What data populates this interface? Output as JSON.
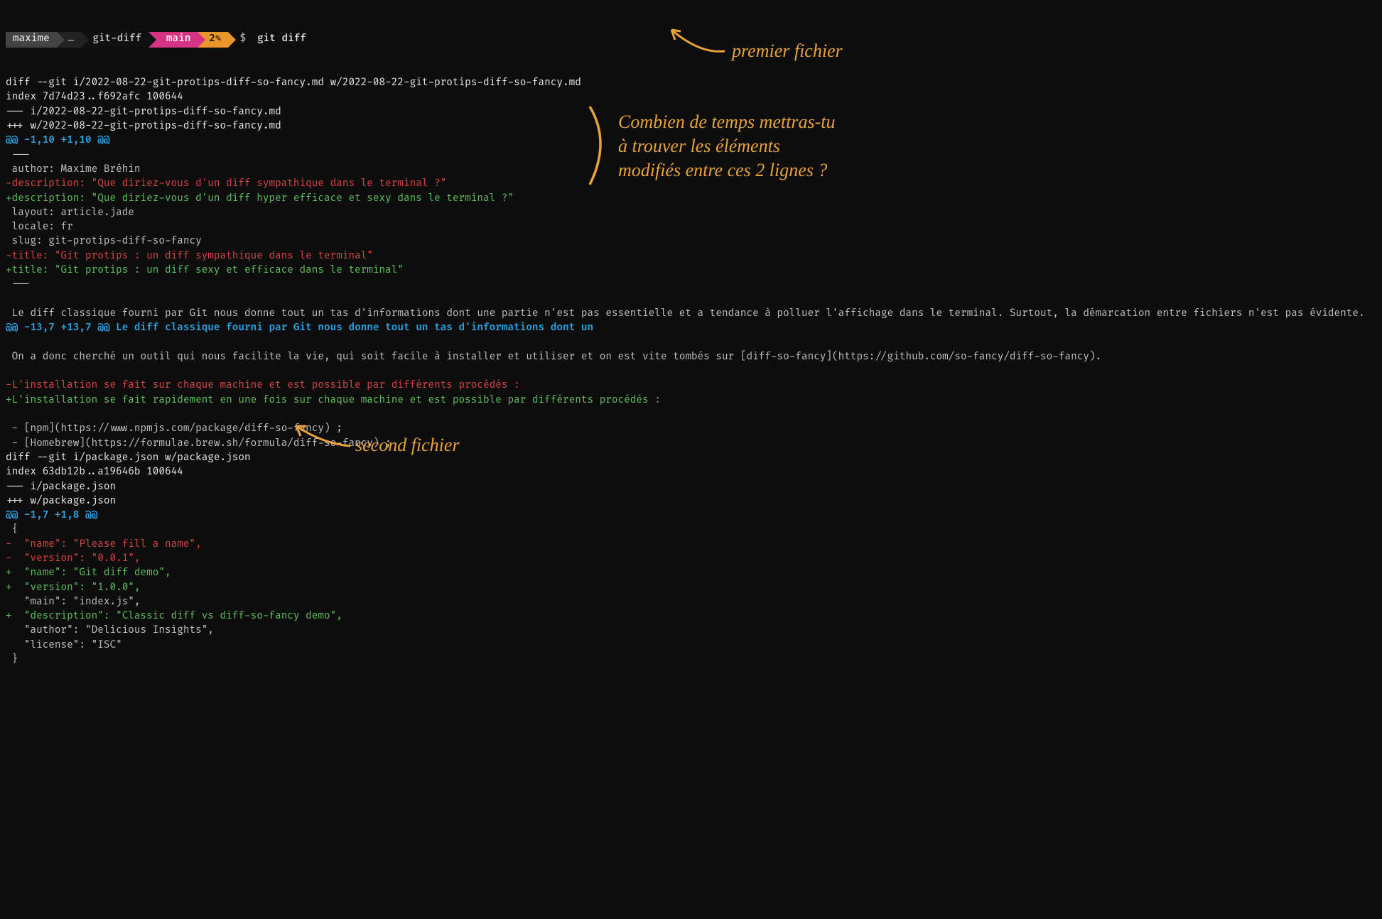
{
  "prompt": {
    "user": "maxime",
    "dots": "…",
    "dir": "git-diff",
    "branch_icon": " ",
    "branch": "main",
    "count": "2",
    "modified_icon": "✎",
    "dollar": "$",
    "command": "git diff"
  },
  "diff": {
    "lines": [
      {
        "c": "white",
        "t": "diff --git i/2022-08-22-git-protips-diff-so-fancy.md w/2022-08-22-git-protips-diff-so-fancy.md"
      },
      {
        "c": "white",
        "t": "index 7d74d23..f692afc 100644"
      },
      {
        "c": "white",
        "t": "--- i/2022-08-22-git-protips-diff-so-fancy.md"
      },
      {
        "c": "white",
        "t": "+++ w/2022-08-22-git-protips-diff-so-fancy.md"
      },
      {
        "c": "cyan",
        "t": "@@ -1,10 +1,10 @@"
      },
      {
        "c": "ctx",
        "t": " ---"
      },
      {
        "c": "ctx",
        "t": " author: Maxime Bréhin"
      },
      {
        "c": "red",
        "t": "-description: \"Que diriez-vous d'un diff sympathique dans le terminal ?\""
      },
      {
        "c": "green",
        "t": "+description: \"Que diriez-vous d'un diff hyper efficace et sexy dans le terminal ?\""
      },
      {
        "c": "ctx",
        "t": " layout: article.jade"
      },
      {
        "c": "ctx",
        "t": " locale: fr"
      },
      {
        "c": "ctx",
        "t": " slug: git-protips-diff-so-fancy"
      },
      {
        "c": "red",
        "t": "-title: \"Git protips : un diff sympathique dans le terminal\""
      },
      {
        "c": "green",
        "t": "+title: \"Git protips : un diff sexy et efficace dans le terminal\""
      },
      {
        "c": "ctx",
        "t": " ---"
      },
      {
        "c": "ctx",
        "t": " "
      },
      {
        "c": "ctx",
        "t": " Le diff classique fourni par Git nous donne tout un tas d'informations dont une partie n'est pas essentielle et a tendance à polluer l'affichage dans le terminal. Surtout, la démarcation entre fichiers n'est pas évidente."
      },
      {
        "c": "cyan",
        "t": "@@ -13,7 +13,7 @@ Le diff classique fourni par Git nous donne tout un tas d'informations dont un"
      },
      {
        "c": "ctx",
        "t": " "
      },
      {
        "c": "ctx",
        "t": " On a donc cherché un outil qui nous facilite la vie, qui soit facile à installer et utiliser et on est vite tombés sur [diff-so-fancy](https://github.com/so-fancy/diff-so-fancy)."
      },
      {
        "c": "ctx",
        "t": " "
      },
      {
        "c": "red",
        "t": "-L'installation se fait sur chaque machine et est possible par différents procédés :"
      },
      {
        "c": "green",
        "t": "+L'installation se fait rapidement en une fois sur chaque machine et est possible par différents procédés :"
      },
      {
        "c": "ctx",
        "t": " "
      },
      {
        "c": "ctx",
        "t": " - [npm](https://www.npmjs.com/package/diff-so-fancy) ;"
      },
      {
        "c": "ctx",
        "t": " - [Homebrew](https://formulae.brew.sh/formula/diff-so-fancy) ;"
      },
      {
        "c": "white",
        "t": "diff --git i/package.json w/package.json"
      },
      {
        "c": "white",
        "t": "index 63db12b..a19646b 100644"
      },
      {
        "c": "white",
        "t": "--- i/package.json"
      },
      {
        "c": "white",
        "t": "+++ w/package.json"
      },
      {
        "c": "cyan",
        "t": "@@ -1,7 +1,8 @@"
      },
      {
        "c": "ctx",
        "t": " {"
      },
      {
        "c": "red",
        "t": "-  \"name\": \"Please fill a name\","
      },
      {
        "c": "red",
        "t": "-  \"version\": \"0.0.1\","
      },
      {
        "c": "green",
        "t": "+  \"name\": \"Git diff demo\","
      },
      {
        "c": "green",
        "t": "+  \"version\": \"1.0.0\","
      },
      {
        "c": "ctx",
        "t": "   \"main\": \"index.js\","
      },
      {
        "c": "green",
        "t": "+  \"description\": \"Classic diff vs diff-so-fancy demo\","
      },
      {
        "c": "ctx",
        "t": "   \"author\": \"Delicious Insights\","
      },
      {
        "c": "ctx",
        "t": "   \"license\": \"ISC\""
      },
      {
        "c": "ctx",
        "t": " }"
      }
    ]
  },
  "annotations": {
    "premier_fichier": "premier fichier",
    "combien": "Combien de temps mettras-tu\nà trouver les éléments\nmodifiés entre ces 2 lignes ?",
    "second_fichier": "second fichier"
  }
}
